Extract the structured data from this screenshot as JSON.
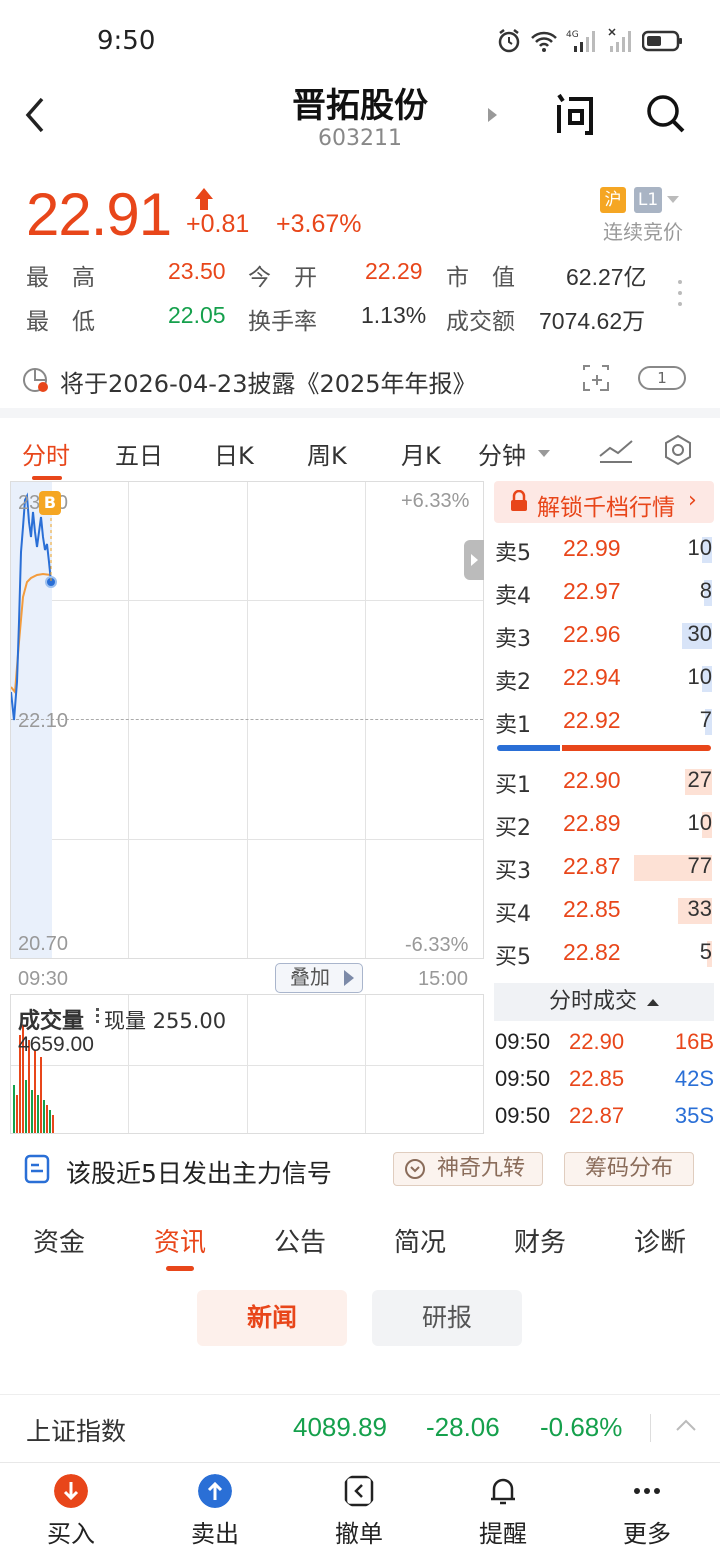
{
  "status": {
    "time": "9:50"
  },
  "header": {
    "name": "晋拓股份",
    "code": "603211"
  },
  "quote": {
    "price": "22.91",
    "change": "+0.81",
    "change_pct": "+3.67%",
    "exchange_badge": "沪",
    "level_badge": "L1",
    "trade_mode": "连续竞价"
  },
  "stats": [
    {
      "label": "最　高",
      "value": "23.50",
      "color": "#e8461a"
    },
    {
      "label": "今　开",
      "value": "22.29",
      "color": "#e8461a"
    },
    {
      "label": "市　值",
      "value": "62.27亿",
      "color": "#333333"
    },
    {
      "label": "最　低",
      "value": "22.05",
      "color": "#15a04c"
    },
    {
      "label": "换手率",
      "value": "1.13%",
      "color": "#333333"
    },
    {
      "label": "成交额",
      "value": "7074.62万",
      "color": "#333333"
    }
  ],
  "notice": {
    "text": "将于2026-04-23披露《2025年年报》",
    "badge": "1"
  },
  "chart_tabs": [
    "分时",
    "五日",
    "日K",
    "周K",
    "月K",
    "分钟"
  ],
  "chart": {
    "high_price": "23.50",
    "mid_price": "22.10",
    "low_price": "20.70",
    "high_pct": "+6.33%",
    "low_pct": "-6.33%",
    "start_time": "09:30",
    "end_time": "15:00",
    "marker": "B",
    "overlay_label": "叠加",
    "volume_label": "成交量",
    "current_volume": "现量 255.00",
    "max_volume": "4659.00"
  },
  "orderbook": {
    "unlock_label": "解锁千档行情",
    "asks": [
      {
        "label": "卖5",
        "price": "22.99",
        "vol": "10",
        "ratio": 0.13
      },
      {
        "label": "卖4",
        "price": "22.97",
        "vol": "8",
        "ratio": 0.1
      },
      {
        "label": "卖3",
        "price": "22.96",
        "vol": "30",
        "ratio": 0.39
      },
      {
        "label": "卖2",
        "price": "22.94",
        "vol": "10",
        "ratio": 0.13
      },
      {
        "label": "卖1",
        "price": "22.92",
        "vol": "7",
        "ratio": 0.09
      }
    ],
    "bids": [
      {
        "label": "买1",
        "price": "22.90",
        "vol": "27",
        "ratio": 0.35
      },
      {
        "label": "买2",
        "price": "22.89",
        "vol": "10",
        "ratio": 0.13
      },
      {
        "label": "买3",
        "price": "22.87",
        "vol": "77",
        "ratio": 1.0
      },
      {
        "label": "买4",
        "price": "22.85",
        "vol": "33",
        "ratio": 0.43
      },
      {
        "label": "买5",
        "price": "22.82",
        "vol": "5",
        "ratio": 0.06
      }
    ],
    "buy_sell_ratio": 0.3
  },
  "ticks": {
    "header": "分时成交",
    "rows": [
      {
        "time": "09:50",
        "price": "22.90",
        "vol": "16B",
        "dir": "B"
      },
      {
        "time": "09:50",
        "price": "22.85",
        "vol": "42S",
        "dir": "S"
      },
      {
        "time": "09:50",
        "price": "22.87",
        "vol": "35S",
        "dir": "S"
      }
    ]
  },
  "signal": {
    "text": "该股近5日发出主力信号",
    "btn1": "神奇九转",
    "btn2": "筹码分布"
  },
  "sub_tabs": [
    "资金",
    "资讯",
    "公告",
    "简况",
    "财务",
    "诊断"
  ],
  "segments": [
    "新闻",
    "研报"
  ],
  "index": {
    "name": "上证指数",
    "value": "4089.89",
    "change": "-28.06",
    "pct": "-0.68%"
  },
  "bottom_nav": [
    "买入",
    "卖出",
    "撤单",
    "提醒",
    "更多"
  ],
  "colors": {
    "up": "#e8461a",
    "down": "#15a04c",
    "price_line": "#2a6fd6",
    "avg_line": "#f39c3d"
  }
}
